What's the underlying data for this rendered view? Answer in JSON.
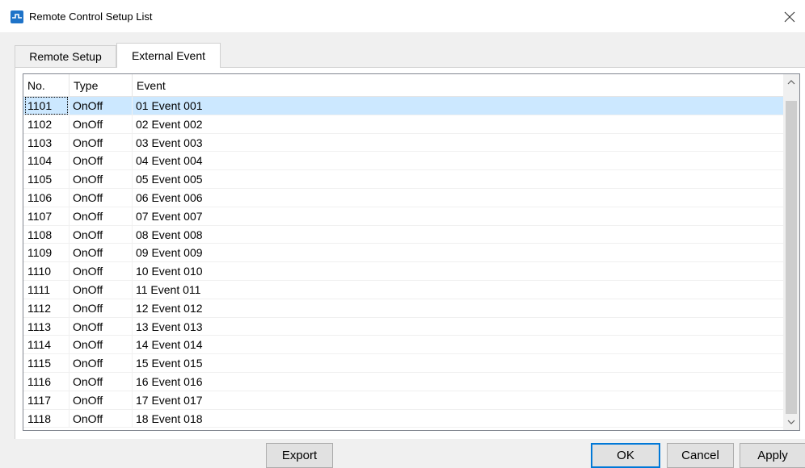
{
  "window": {
    "title": "Remote Control Setup List"
  },
  "tabs": [
    {
      "label": "Remote Setup",
      "active": false
    },
    {
      "label": "External Event",
      "active": true
    }
  ],
  "table": {
    "columns": {
      "no": "No.",
      "type": "Type",
      "event": "Event"
    },
    "selected_index": 0,
    "rows": [
      {
        "no": "1101",
        "type": "OnOff",
        "event": "01 Event 001"
      },
      {
        "no": "1102",
        "type": "OnOff",
        "event": "02 Event 002"
      },
      {
        "no": "1103",
        "type": "OnOff",
        "event": "03 Event 003"
      },
      {
        "no": "1104",
        "type": "OnOff",
        "event": "04 Event 004"
      },
      {
        "no": "1105",
        "type": "OnOff",
        "event": "05 Event 005"
      },
      {
        "no": "1106",
        "type": "OnOff",
        "event": "06 Event 006"
      },
      {
        "no": "1107",
        "type": "OnOff",
        "event": "07 Event 007"
      },
      {
        "no": "1108",
        "type": "OnOff",
        "event": "08 Event 008"
      },
      {
        "no": "1109",
        "type": "OnOff",
        "event": "09 Event 009"
      },
      {
        "no": "1110",
        "type": "OnOff",
        "event": "10 Event 010"
      },
      {
        "no": "1111",
        "type": "OnOff",
        "event": "11 Event 011"
      },
      {
        "no": "1112",
        "type": "OnOff",
        "event": "12 Event 012"
      },
      {
        "no": "1113",
        "type": "OnOff",
        "event": "13 Event 013"
      },
      {
        "no": "1114",
        "type": "OnOff",
        "event": "14 Event 014"
      },
      {
        "no": "1115",
        "type": "OnOff",
        "event": "15 Event 015"
      },
      {
        "no": "1116",
        "type": "OnOff",
        "event": "16 Event 016"
      },
      {
        "no": "1117",
        "type": "OnOff",
        "event": "17 Event 017"
      },
      {
        "no": "1118",
        "type": "OnOff",
        "event": "18 Event 018"
      }
    ]
  },
  "buttons": {
    "export": "Export",
    "ok": "OK",
    "cancel": "Cancel",
    "apply": "Apply"
  },
  "colors": {
    "selection": "#cce8ff",
    "accent": "#0078d7",
    "app_icon": "#1e73c8"
  },
  "icons": {
    "app": "remote-control-app-icon",
    "close": "close-icon",
    "scroll_up": "chevron-up-icon",
    "scroll_down": "chevron-down-icon"
  }
}
